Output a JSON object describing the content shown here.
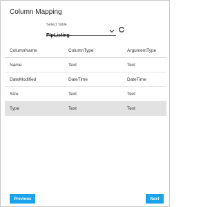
{
  "dialog": {
    "title": "Column Mapping"
  },
  "select_table": {
    "label": "Select Table",
    "value": "FtpListing"
  },
  "table": {
    "headers": [
      "ColumnName",
      "ColumnType",
      "ArgumentType"
    ],
    "rows": [
      {
        "name": "Name",
        "column_type": "Text",
        "argument_type": "Text"
      },
      {
        "name": "DateModified",
        "column_type": "DateTime",
        "argument_type": "DateTime"
      },
      {
        "name": "Size",
        "column_type": "Text",
        "argument_type": "Text"
      },
      {
        "name": "Type",
        "column_type": "Text",
        "argument_type": "Text"
      }
    ],
    "selected_row": "Type"
  },
  "buttons": {
    "previous": "Previous",
    "next": "Next"
  },
  "colors": {
    "accent": "#1aa3ea",
    "selected_row": "#e2e2e2"
  }
}
